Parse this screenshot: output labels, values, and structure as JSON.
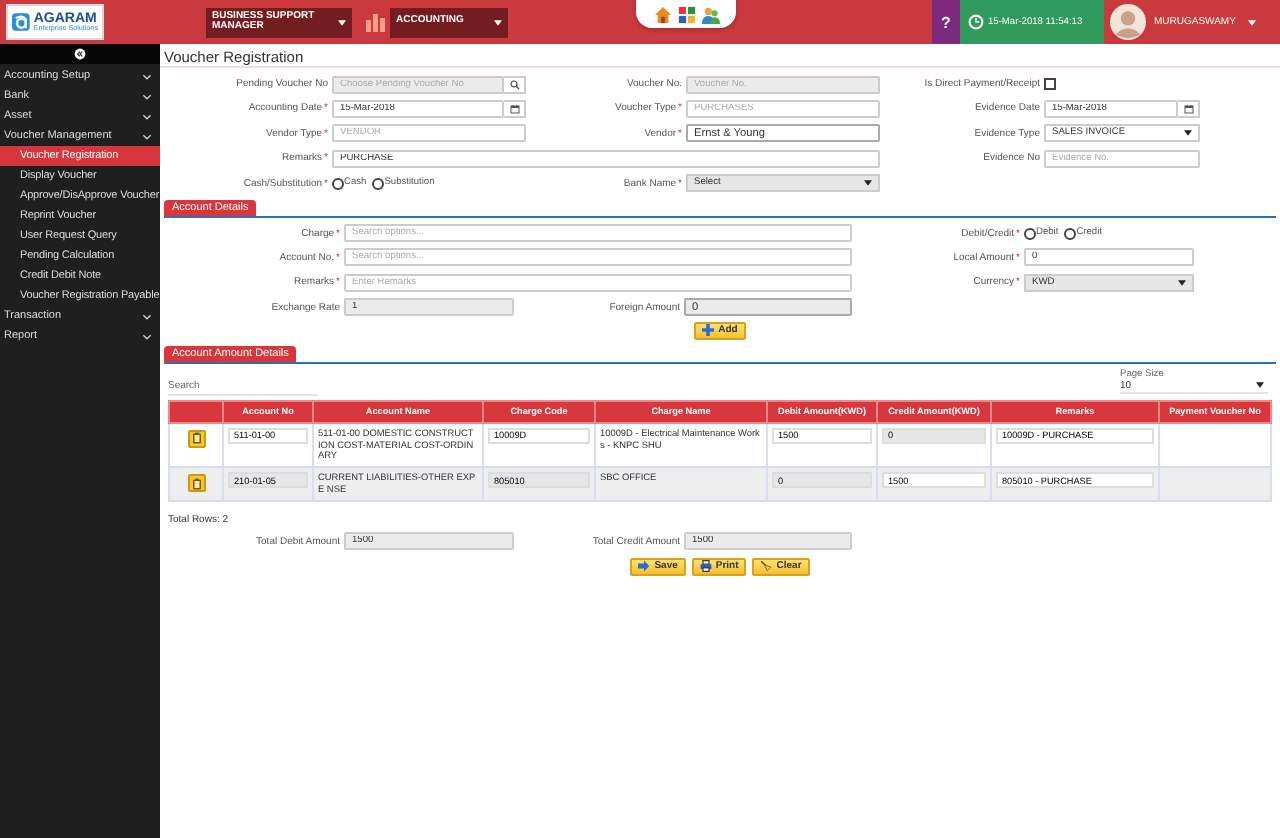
{
  "header": {
    "logo": {
      "name": "AGARAM",
      "tagline": "Enterprise Solutions"
    },
    "role_select": "BUSINESS SUPPORT MANAGER",
    "module_select": "ACCOUNTING",
    "help": "?",
    "datetime": "15-Mar-2018 11:54:13",
    "user": "MURUGASWAMY"
  },
  "sidebar": [
    {
      "label": "Accounting Setup",
      "selected": false
    },
    {
      "label": "Bank",
      "selected": false
    },
    {
      "label": "Asset",
      "selected": false
    },
    {
      "label": "Voucher Management",
      "selected": false,
      "children": [
        {
          "label": "Voucher Registration",
          "selected": true
        },
        {
          "label": "Display Voucher",
          "selected": false
        },
        {
          "label": "Approve/DisApprove Voucher",
          "selected": false
        },
        {
          "label": "Reprint Voucher",
          "selected": false
        },
        {
          "label": "User Request Query",
          "selected": false
        },
        {
          "label": "Pending Calculation",
          "selected": false
        },
        {
          "label": "Credit Debit Note",
          "selected": false
        },
        {
          "label": "Voucher Registration Payable",
          "selected": false
        }
      ]
    },
    {
      "label": "Transaction",
      "selected": false
    },
    {
      "label": "Report",
      "selected": false
    }
  ],
  "page_title": "Voucher Registration",
  "voucher_form": [
    {
      "left": {
        "label": "Pending Voucher No",
        "kind": "search",
        "placeholder": "Choose Pending Voucher No",
        "disabled": true
      },
      "middle": {
        "label": "Voucher No.",
        "kind": "text",
        "placeholder": "Voucher No.",
        "disabled": true
      },
      "right": {
        "label": "Is Direct Payment/Receipt",
        "kind": "checkbox",
        "checked": false
      }
    },
    {
      "left": {
        "label": "Accounting Date",
        "mark": "*",
        "kind": "date",
        "value": "15-Mar-2018",
        "disabled": false
      },
      "middle": {
        "label": "Voucher Type",
        "mark": "*",
        "kind": "text",
        "placeholder": "PURCHASES",
        "disabled": false
      },
      "right": {
        "label": "Evidence Date",
        "kind": "date",
        "value": "15-Mar-2018",
        "disabled": false
      }
    },
    {
      "left": {
        "label": "Vendor Type",
        "mark": "*",
        "kind": "text",
        "placeholder": "VENDOR",
        "disabled": false
      },
      "middle": {
        "label": "Vendor",
        "mark": "*",
        "kind": "text",
        "value": "Ernst & Young",
        "disabled": false
      },
      "right": {
        "label": "Evidence Type",
        "kind": "select",
        "value": "SALES INVOICE",
        "disabled": false
      }
    },
    {
      "left": {
        "label": "Remarks",
        "mark": "*",
        "kind": "text",
        "value": "PURCHASE",
        "disabled": false
      },
      "right": {
        "label": "Evidence No",
        "kind": "text",
        "placeholder": "Evidence No.",
        "disabled": false
      }
    },
    {
      "left": {
        "label": "Cash/Substitution",
        "mark": "*",
        "kind": "radio",
        "options": [
          {
            "label": "Cash",
            "selected": false
          },
          {
            "label": "Substitution",
            "selected": false
          }
        ]
      },
      "middle": {
        "label": "Bank Name",
        "mark": "*",
        "kind": "select",
        "value": "Select",
        "disabled": true
      }
    }
  ],
  "account_details": {
    "title": "Account Details",
    "rows": [
      {
        "left": {
          "label": "Charge",
          "mark": "*",
          "kind": "text",
          "placeholder": "Search options...",
          "disabled": false
        },
        "right": {
          "label": "Debit/Credit",
          "mark": "*",
          "kind": "radio",
          "options": [
            {
              "label": "Debit",
              "selected": false
            },
            {
              "label": "Credit",
              "selected": false
            }
          ]
        }
      },
      {
        "left": {
          "label": "Account No.",
          "mark": "*",
          "kind": "text",
          "placeholder": "Search options...",
          "disabled": false
        },
        "right": {
          "label": "Local Amount",
          "mark": "*",
          "kind": "text",
          "value": "0",
          "disabled": false
        }
      },
      {
        "left": {
          "label": "Remarks",
          "mark": "*",
          "kind": "text",
          "placeholder": "Enter Remarks",
          "disabled": false
        },
        "right": {
          "label": "Currency",
          "mark": "*",
          "kind": "select",
          "value": "KWD",
          "disabled": true
        }
      },
      {
        "left": {
          "label": "Exchange Rate",
          "kind": "text",
          "value": "1",
          "disabled": true
        },
        "middle": {
          "label": "Foreign Amount",
          "kind": "text",
          "value": "0",
          "disabled": true
        }
      }
    ],
    "add_button": "Add"
  },
  "amount_details": {
    "title": "Account Amount Details",
    "search_placeholder": "Search",
    "page_size": {
      "label": "Page Size",
      "value": "10"
    },
    "columns": [
      "Account No",
      "Account Name",
      "Charge Code",
      "Charge Name",
      "Debit Amount(KWD)",
      "Credit Amount(KWD)",
      "Remarks",
      "Payment Voucher No"
    ],
    "rows": [
      {
        "cells": [
          {
            "kind": "input",
            "value": "511-01-00",
            "disabled": false
          },
          {
            "kind": "text",
            "value": "511-01-00 DOMESTIC CONSTRUCT ION COST-MATERIAL COST-ORDIN ARY"
          },
          {
            "kind": "input",
            "value": "10009D",
            "disabled": false
          },
          {
            "kind": "text",
            "value": "10009D - Electrical Maintenance Works - KNPC SHU"
          },
          {
            "kind": "input",
            "value": "1500",
            "disabled": false
          },
          {
            "kind": "input",
            "value": "0",
            "disabled": true
          },
          {
            "kind": "input",
            "value": "10009D - PURCHASE",
            "disabled": false
          }
        ]
      },
      {
        "cells": [
          {
            "kind": "input",
            "value": "210-01-05",
            "disabled": true
          },
          {
            "kind": "text",
            "value": "CURRENT LIABILITIES-OTHER EXPE NSE"
          },
          {
            "kind": "input",
            "value": "805010",
            "disabled": true
          },
          {
            "kind": "text",
            "value": "SBC OFFICE"
          },
          {
            "kind": "input",
            "value": "0",
            "disabled": true
          },
          {
            "kind": "input",
            "value": "1500",
            "disabled": false
          },
          {
            "kind": "input",
            "value": "805010 - PURCHASE",
            "disabled": false
          }
        ]
      }
    ],
    "total_rows": "Total Rows: 2"
  },
  "totals": [
    {
      "label": "Total Debit Amount",
      "value": "1500"
    },
    {
      "label": "Total Credit Amount",
      "value": "1500"
    }
  ],
  "actions": [
    {
      "label": "Save",
      "kind": "save"
    },
    {
      "label": "Print",
      "kind": "print"
    },
    {
      "label": "Clear",
      "kind": "clear"
    }
  ]
}
